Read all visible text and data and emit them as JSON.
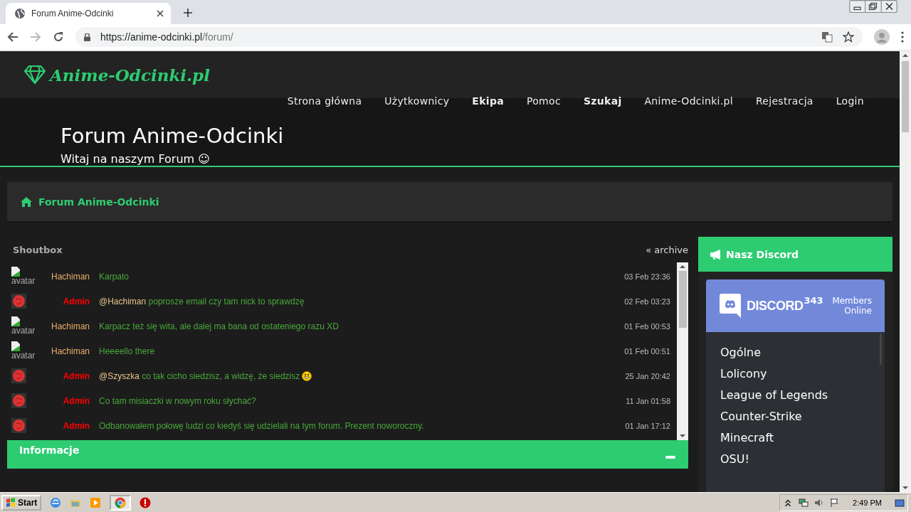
{
  "browser": {
    "tab_title": "Forum Anime-Odcinki",
    "url_host": "https://anime-odcinki.pl",
    "url_path": "/forum/"
  },
  "site": {
    "logo": "Anime-Odcinki.pl",
    "nav": [
      {
        "label": "Strona główna",
        "bold": false
      },
      {
        "label": "Użytkownicy",
        "bold": false
      },
      {
        "label": "Ekipa",
        "bold": true
      },
      {
        "label": "Pomoc",
        "bold": false
      },
      {
        "label": "Szukaj",
        "bold": true
      },
      {
        "label": "Anime-Odcinki.pl",
        "bold": false
      },
      {
        "label": "Rejestracja",
        "bold": false
      },
      {
        "label": "Login",
        "bold": false
      }
    ],
    "hero_title": "Forum Anime-Odcinki",
    "hero_subtitle": "Witaj na naszym Forum ☺"
  },
  "breadcrumb": "Forum Anime-Odcinki",
  "shoutbox": {
    "title": "Shoutbox",
    "archive": "« archive",
    "rows": [
      {
        "kind": "broken",
        "alt": "avatar",
        "user": "Hachiman",
        "admin": false,
        "text": "Karpato",
        "time": "03 Feb 23:36"
      },
      {
        "kind": "admin",
        "user": "Admin",
        "admin": true,
        "mention": "@Hachiman",
        "text": "poprosze email czy tam nick to sprawdzę",
        "time": "02 Feb 03:23"
      },
      {
        "kind": "broken",
        "alt": "avatar",
        "user": "Hachiman",
        "admin": false,
        "text": "Karpacz też się wita, ale dalej ma bana od ostateniego razu XD",
        "time": "01 Feb 00:53"
      },
      {
        "kind": "broken",
        "alt": "avatar",
        "user": "Hachiman",
        "admin": false,
        "text": "Heeeello there",
        "time": "01 Feb 00:51"
      },
      {
        "kind": "admin",
        "user": "Admin",
        "admin": true,
        "mention": "@Szyszka",
        "text": "co tak cicho siedzisz, a widzę, że siedzisz",
        "emoji": true,
        "time": "25 Jan 20:42"
      },
      {
        "kind": "admin",
        "user": "Admin",
        "admin": true,
        "text": "Co tam misiaczki w nowym roku słychać?",
        "time": "11 Jan 01:58"
      },
      {
        "kind": "admin",
        "user": "Admin",
        "admin": true,
        "text": "Odbanowałem połowę ludzi co kiedyś się udzielali na tym forum. Prezent noworoczny.",
        "time": "01 Jan 17:12"
      }
    ]
  },
  "info_title": "Informacje",
  "discord": {
    "title": "Nasz Discord",
    "brand": "DISCORD",
    "count": "343",
    "members": "Members",
    "online": "Online",
    "channels": [
      "Ogólne",
      "Lolicony",
      "League of Legends",
      "Counter-Strike",
      "Minecraft",
      "OSU!"
    ]
  },
  "taskbar": {
    "start": "Start",
    "time": "2:49 PM"
  }
}
